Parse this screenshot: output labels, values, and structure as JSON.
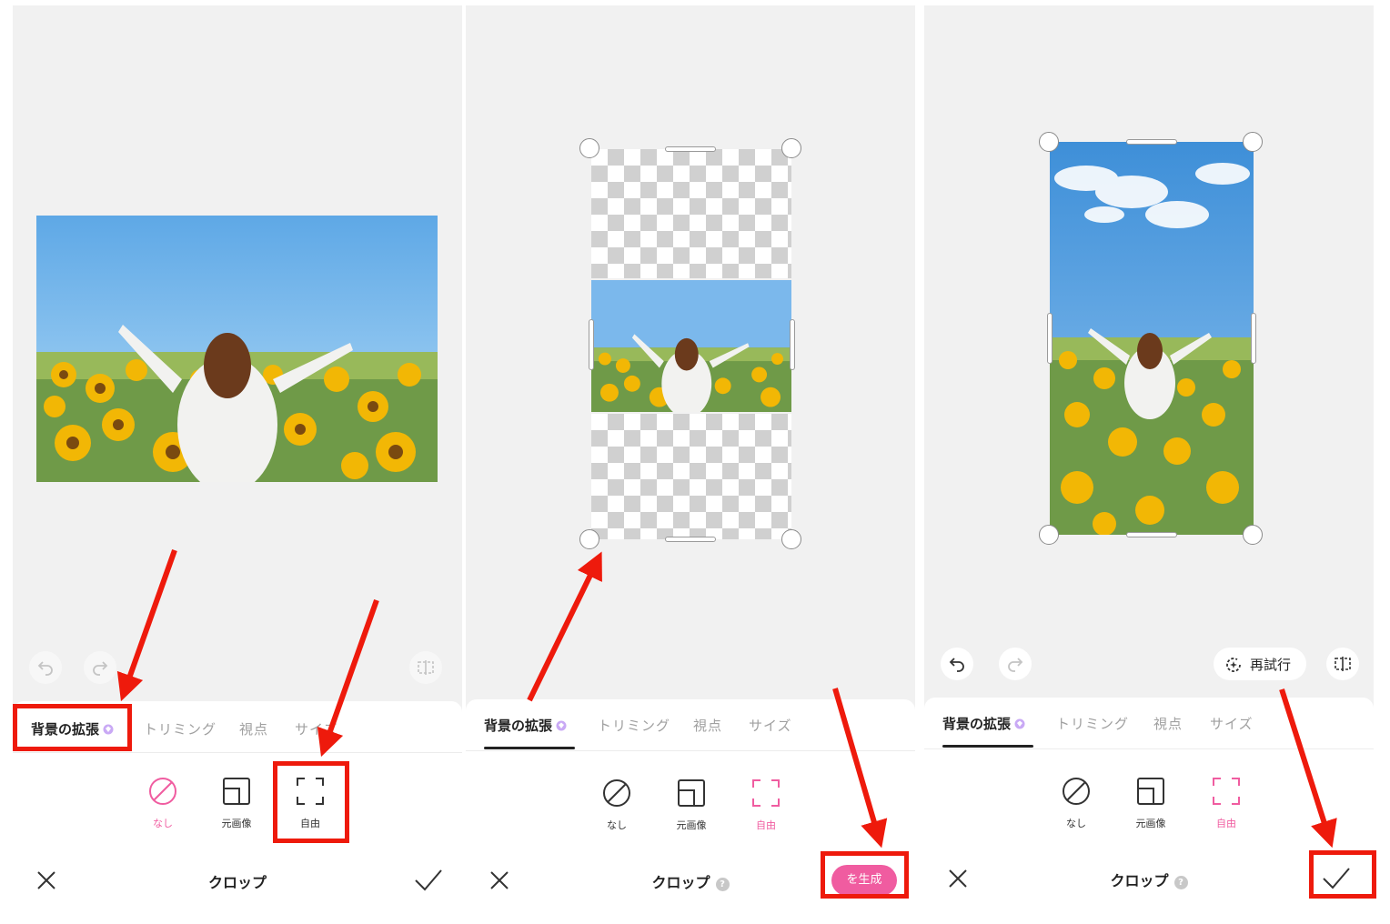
{
  "tabs": {
    "expand": "背景の拡張",
    "trim": "トリミング",
    "perspective": "視点",
    "size": "サイズ"
  },
  "options": {
    "none": "なし",
    "original": "元画像",
    "free": "自由"
  },
  "bottom": {
    "title": "クロップ",
    "help_icon": "?",
    "generate": "を生成"
  },
  "toolbar": {
    "retry": "再試行"
  },
  "colors": {
    "accent": "#f05ca0",
    "highlight": "#ee1a0c",
    "sky": "#8ec3f0"
  },
  "icons": [
    "undo-icon",
    "redo-icon",
    "compare-icon",
    "slash-circle-icon",
    "original-ratio-icon",
    "free-crop-icon",
    "close-icon",
    "check-icon",
    "retry-sparkle-icon",
    "gem-icon"
  ]
}
